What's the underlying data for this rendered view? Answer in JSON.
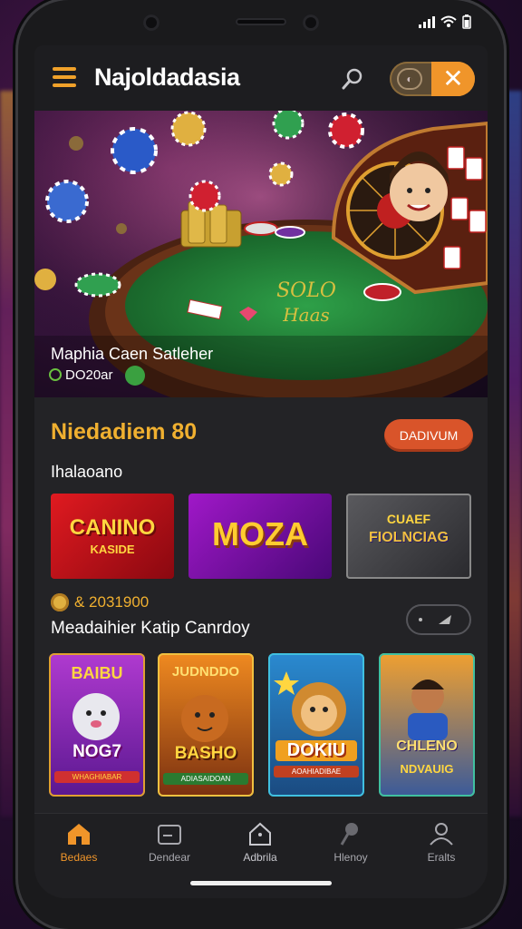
{
  "app": {
    "title": "Najoldadasia"
  },
  "hero": {
    "title": "Maphia Caen Satleher",
    "subtitle": "DO20ar"
  },
  "section": {
    "title": "Niedadiem 80",
    "button_label": "DADIVUM",
    "sub_label": "Ihalaoano"
  },
  "tiles": [
    {
      "line1": "CANINO",
      "line2": "KASIDE"
    },
    {
      "line1": "MOZA",
      "line2": ""
    },
    {
      "line1": "CUAEF",
      "line2": "FIOLNCIAG"
    }
  ],
  "row": {
    "meta": "& 2031900",
    "label": "Meadaihier Katip Canrdoy"
  },
  "cards": [
    {
      "top": "BAIBU",
      "title": "NOG7",
      "sub": "WHAGHIABAR"
    },
    {
      "top": "JUDNDDO",
      "title": "BASHO",
      "sub": "ADIASAIDOAN"
    },
    {
      "top": "",
      "title": "DOKIU",
      "sub": "AOAHIADIBAE"
    },
    {
      "top": "",
      "title": "CHLENO",
      "sub": "NDVAUIG"
    }
  ],
  "nav": {
    "items": [
      {
        "label": "Bedaes",
        "icon": "home-icon",
        "active": true
      },
      {
        "label": "Dendear",
        "icon": "wallet-icon",
        "active": false
      },
      {
        "label": "Adbrila",
        "icon": "house-outline-icon",
        "active": false
      },
      {
        "label": "Hlenoy",
        "icon": "pin-icon",
        "active": false
      },
      {
        "label": "Eralts",
        "icon": "user-icon",
        "active": false
      }
    ]
  },
  "colors": {
    "accent": "#f0a12a",
    "button": "#d9542a",
    "background": "#232326"
  }
}
